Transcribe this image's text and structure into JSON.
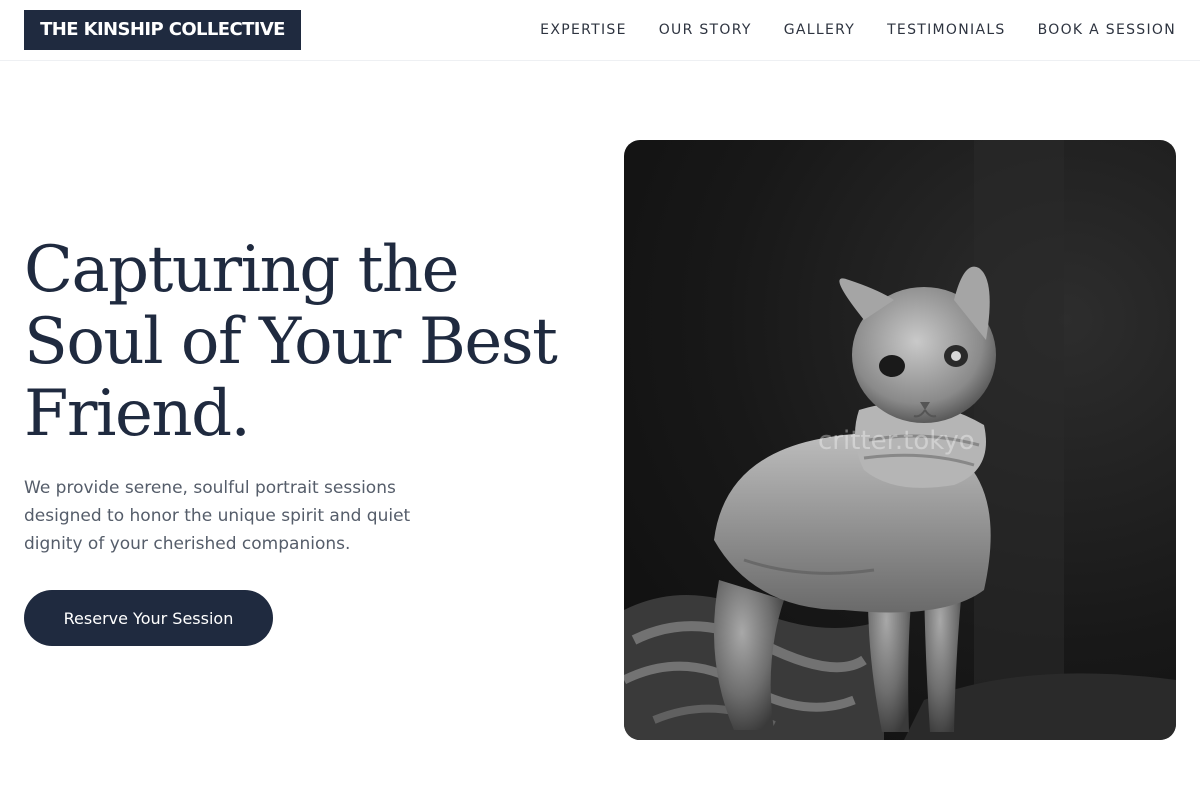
{
  "brand": {
    "name": "THE KINSHIP COLLECTIVE"
  },
  "nav": {
    "items": [
      {
        "label": "EXPERTISE"
      },
      {
        "label": "OUR STORY"
      },
      {
        "label": "GALLERY"
      },
      {
        "label": "TESTIMONIALS"
      },
      {
        "label": "BOOK A SESSION"
      }
    ]
  },
  "hero": {
    "title_lines": [
      "Capturing the",
      "Soul of Your Best",
      "Friend."
    ],
    "subtitle": "We provide serene, soulful portrait sessions designed to honor the unique spirit and quiet dignity of your cherished companions.",
    "cta_label": "Reserve Your Session",
    "image_alt": "Black and white photo of a hairless sphynx cat wearing a knit sweater",
    "watermark": "critter.tokyo"
  },
  "colors": {
    "primary": "#1f2a3f",
    "text": "#2e3440",
    "muted": "#555d6a",
    "background": "#ffffff"
  }
}
